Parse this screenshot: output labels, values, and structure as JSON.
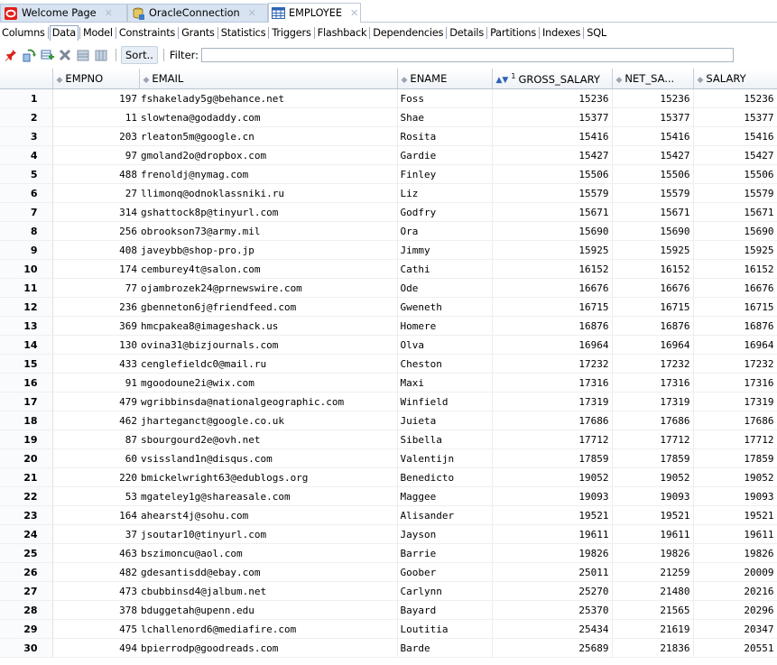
{
  "tabs": [
    {
      "label": "Welcome Page",
      "icon": "oracle-logo-icon",
      "active": false
    },
    {
      "label": "OracleConnection",
      "icon": "database-connection-icon",
      "active": false
    },
    {
      "label": "EMPLOYEE",
      "icon": "table-icon",
      "active": true
    }
  ],
  "subtabs": [
    "Columns",
    "Data",
    "Model",
    "Constraints",
    "Grants",
    "Statistics",
    "Triggers",
    "Flashback",
    "Dependencies",
    "Details",
    "Partitions",
    "Indexes",
    "SQL"
  ],
  "active_subtab": "Data",
  "toolbar": {
    "sort_label": "Sort..",
    "filter_label": "Filter:",
    "filter_value": ""
  },
  "columns": [
    "EMPNO",
    "EMAIL",
    "ENAME",
    "GROSS_SALARY",
    "NET_SA...",
    "SALARY"
  ],
  "sorted_column": "GROSS_SALARY",
  "sort_badge": "1",
  "rows": [
    [
      "1",
      "197",
      "fshakelady5g@behance.net",
      "Foss",
      "15236",
      "15236",
      "15236"
    ],
    [
      "2",
      "11",
      "slowtena@godaddy.com",
      "Shae",
      "15377",
      "15377",
      "15377"
    ],
    [
      "3",
      "203",
      "rleaton5m@google.cn",
      "Rosita",
      "15416",
      "15416",
      "15416"
    ],
    [
      "4",
      "97",
      "gmoland2o@dropbox.com",
      "Gardie",
      "15427",
      "15427",
      "15427"
    ],
    [
      "5",
      "488",
      "frenoldj@nymag.com",
      "Finley",
      "15506",
      "15506",
      "15506"
    ],
    [
      "6",
      "27",
      "llimonq@odnoklassniki.ru",
      "Liz",
      "15579",
      "15579",
      "15579"
    ],
    [
      "7",
      "314",
      "gshattock8p@tinyurl.com",
      "Godfry",
      "15671",
      "15671",
      "15671"
    ],
    [
      "8",
      "256",
      "obrookson73@army.mil",
      "Ora",
      "15690",
      "15690",
      "15690"
    ],
    [
      "9",
      "408",
      "javeybb@shop-pro.jp",
      "Jimmy",
      "15925",
      "15925",
      "15925"
    ],
    [
      "10",
      "174",
      "cemburey4t@salon.com",
      "Cathi",
      "16152",
      "16152",
      "16152"
    ],
    [
      "11",
      "77",
      "ojambrozek24@prnewswire.com",
      "Ode",
      "16676",
      "16676",
      "16676"
    ],
    [
      "12",
      "236",
      "gbenneton6j@friendfeed.com",
      "Gweneth",
      "16715",
      "16715",
      "16715"
    ],
    [
      "13",
      "369",
      "hmcpakea8@imageshack.us",
      "Homere",
      "16876",
      "16876",
      "16876"
    ],
    [
      "14",
      "130",
      "ovina31@bizjournals.com",
      "Olva",
      "16964",
      "16964",
      "16964"
    ],
    [
      "15",
      "433",
      "cenglefieldc0@mail.ru",
      "Cheston",
      "17232",
      "17232",
      "17232"
    ],
    [
      "16",
      "91",
      "mgoodoune2i@wix.com",
      "Maxi",
      "17316",
      "17316",
      "17316"
    ],
    [
      "17",
      "479",
      "wgribbinsda@nationalgeographic.com",
      "Winfield",
      "17319",
      "17319",
      "17319"
    ],
    [
      "18",
      "462",
      "jharteganct@google.co.uk",
      "Juieta",
      "17686",
      "17686",
      "17686"
    ],
    [
      "19",
      "87",
      "sbourgourd2e@ovh.net",
      "Sibella",
      "17712",
      "17712",
      "17712"
    ],
    [
      "20",
      "60",
      "vsissland1n@disqus.com",
      "Valentijn",
      "17859",
      "17859",
      "17859"
    ],
    [
      "21",
      "220",
      "bmickelwright63@edublogs.org",
      "Benedicto",
      "19052",
      "19052",
      "19052"
    ],
    [
      "22",
      "53",
      "mgateley1g@shareasale.com",
      "Maggee",
      "19093",
      "19093",
      "19093"
    ],
    [
      "23",
      "164",
      "ahearst4j@sohu.com",
      "Alisander",
      "19521",
      "19521",
      "19521"
    ],
    [
      "24",
      "37",
      "jsoutar10@tinyurl.com",
      "Jayson",
      "19611",
      "19611",
      "19611"
    ],
    [
      "25",
      "463",
      "bszimoncu@aol.com",
      "Barrie",
      "19826",
      "19826",
      "19826"
    ],
    [
      "26",
      "482",
      "gdesantisdd@ebay.com",
      "Goober",
      "25011",
      "21259",
      "20009"
    ],
    [
      "27",
      "473",
      "cbubbinsd4@jalbum.net",
      "Carlynn",
      "25270",
      "21480",
      "20216"
    ],
    [
      "28",
      "378",
      "bduggetah@upenn.edu",
      "Bayard",
      "25370",
      "21565",
      "20296"
    ],
    [
      "29",
      "475",
      "lchallenord6@mediafire.com",
      "Loutitia",
      "25434",
      "21619",
      "20347"
    ],
    [
      "30",
      "494",
      "bpierrodp@goodreads.com",
      "Barde",
      "25689",
      "21836",
      "20551"
    ]
  ]
}
